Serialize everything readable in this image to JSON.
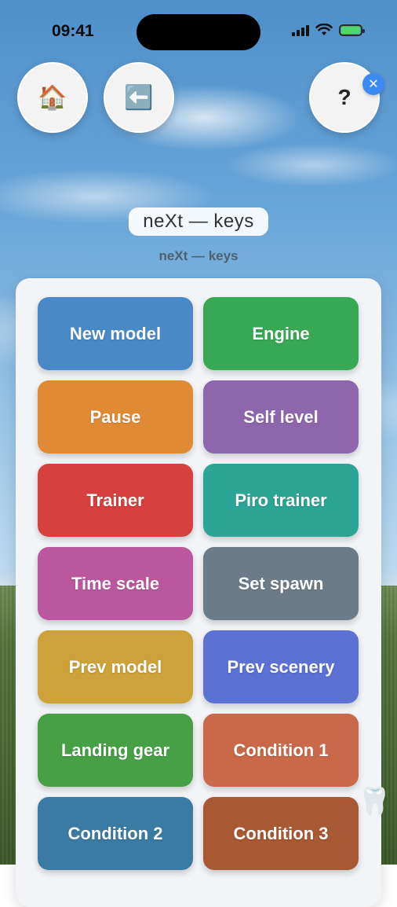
{
  "status_bar": {
    "time": "09:41"
  },
  "nav": {
    "home_icon": "🏠",
    "back_icon": "⬅️",
    "help_label": "?",
    "close_glyph": "✕"
  },
  "header": {
    "title": "neXt — keys",
    "subtitle": "neXt — keys"
  },
  "keys": [
    {
      "label": "New model",
      "color": "#4a89c8"
    },
    {
      "label": "Engine",
      "color": "#37a954"
    },
    {
      "label": "Pause",
      "color": "#e18a36"
    },
    {
      "label": "Self level",
      "color": "#8e66ac"
    },
    {
      "label": "Trainer",
      "color": "#d7403e"
    },
    {
      "label": "Piro trainer",
      "color": "#2aa596"
    },
    {
      "label": "Time scale",
      "color": "#bb579f"
    },
    {
      "label": "Set spawn",
      "color": "#6d7b88"
    },
    {
      "label": "Prev model",
      "color": "#cca239"
    },
    {
      "label": "Prev scenery",
      "color": "#5b72d4"
    },
    {
      "label": "Landing gear",
      "color": "#47a046"
    },
    {
      "label": "Condition 1",
      "color": "#c9694a"
    },
    {
      "label": "Condition 2",
      "color": "#3b7aa3"
    },
    {
      "label": "Condition 3",
      "color": "#a85833"
    }
  ],
  "floating": {
    "tooth_icon": "🦷"
  }
}
